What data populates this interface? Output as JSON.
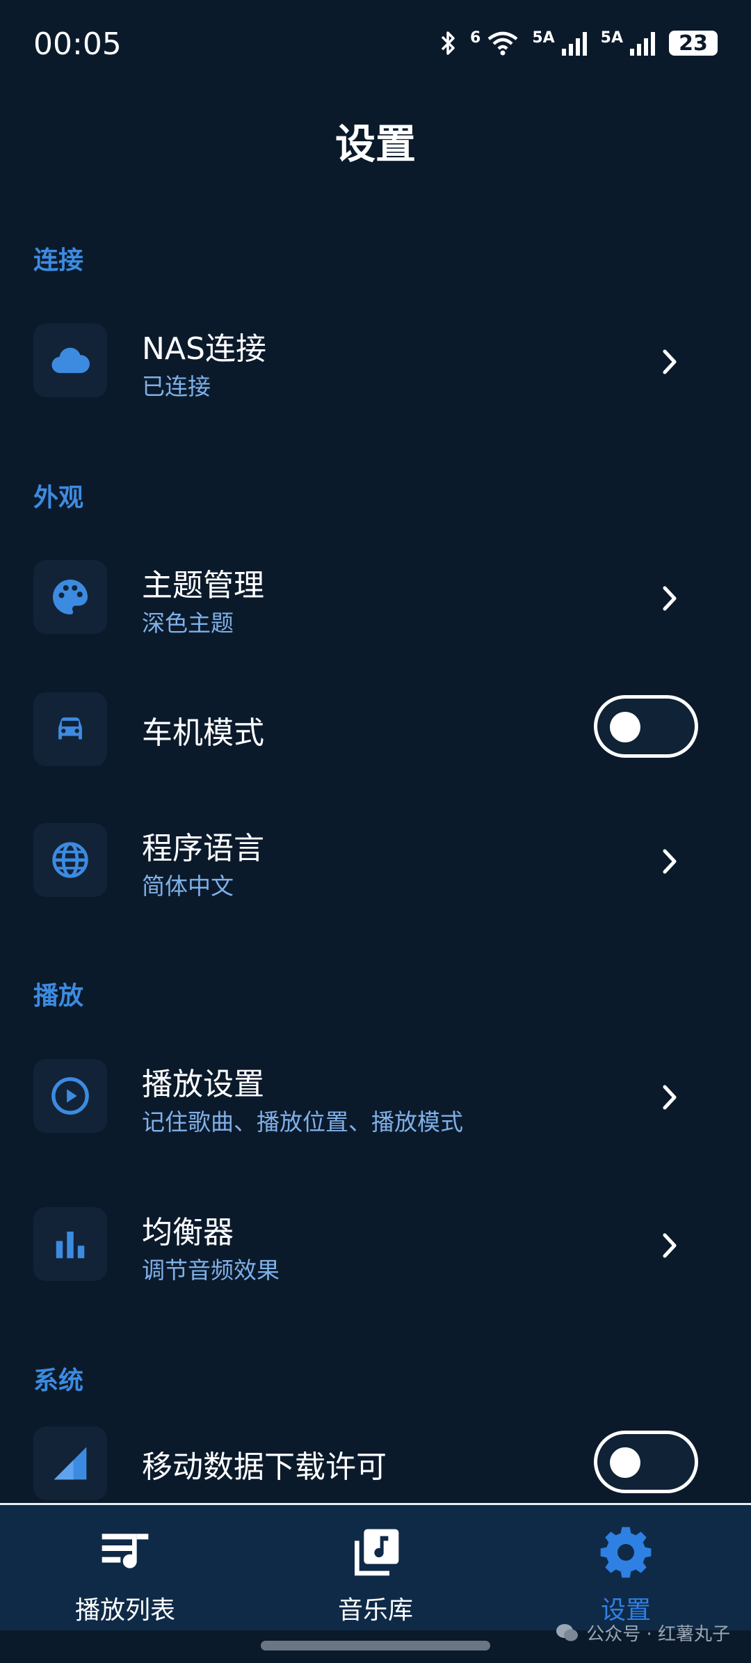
{
  "status_bar": {
    "time": "00:05",
    "battery": "23",
    "wifi_label": "6",
    "signal1_label": "5A",
    "signal2_label": "5A"
  },
  "page": {
    "title": "设置"
  },
  "sections": {
    "connection": {
      "title": "连接",
      "nas": {
        "title": "NAS连接",
        "subtitle": "已连接",
        "icon": "cloud-icon"
      }
    },
    "appearance": {
      "title": "外观",
      "theme": {
        "title": "主题管理",
        "subtitle": "深色主题",
        "icon": "palette-icon"
      },
      "car_mode": {
        "title": "车机模式",
        "icon": "car-icon",
        "toggle_on": false
      },
      "language": {
        "title": "程序语言",
        "subtitle": "简体中文",
        "icon": "globe-icon"
      }
    },
    "playback": {
      "title": "播放",
      "settings": {
        "title": "播放设置",
        "subtitle": "记住歌曲、播放位置、播放模式",
        "icon": "play-circle-icon"
      },
      "equalizer": {
        "title": "均衡器",
        "subtitle": "调节音频效果",
        "icon": "equalizer-icon"
      }
    },
    "system": {
      "title": "系统",
      "mobile_data": {
        "title": "移动数据下载许可",
        "icon": "signal-icon",
        "toggle_on": false
      }
    }
  },
  "bottom_nav": {
    "items": [
      {
        "label": "播放列表",
        "icon": "playlist-icon",
        "active": false
      },
      {
        "label": "音乐库",
        "icon": "music-library-icon",
        "active": false
      },
      {
        "label": "设置",
        "icon": "gear-icon",
        "active": true
      }
    ]
  },
  "watermark": "公众号 · 红薯丸子",
  "colors": {
    "background": "#0b1a2b",
    "accent": "#2f80e3",
    "section_title": "#3d8be0",
    "subtitle": "#7fb0e8",
    "icon_tile": "#122338"
  }
}
